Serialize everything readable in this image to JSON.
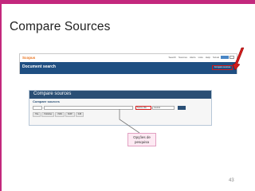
{
  "slide": {
    "title": "Compare Sources",
    "page_number": "43",
    "accent_color": "#c3287d"
  },
  "header_screenshot": {
    "logo": "Scopus",
    "nav_items": [
      "Search",
      "Sources",
      "Alerts",
      "Lists",
      "Help",
      "Scival"
    ],
    "register_label": "",
    "band_title": "Document search",
    "compare_button_label": "Compare sources"
  },
  "compare_screenshot": {
    "panel_title": "Compare sources",
    "section_title": "Compare sources",
    "subject_select": "Source title",
    "type_select": "Journal",
    "tabs": [
      "Title",
      "Publisher",
      "ISSN",
      "SNIP",
      "SJR"
    ]
  },
  "callout": {
    "text": "Opções de pesquisa"
  },
  "icons": {
    "arrow": "red-arrow-icon"
  }
}
